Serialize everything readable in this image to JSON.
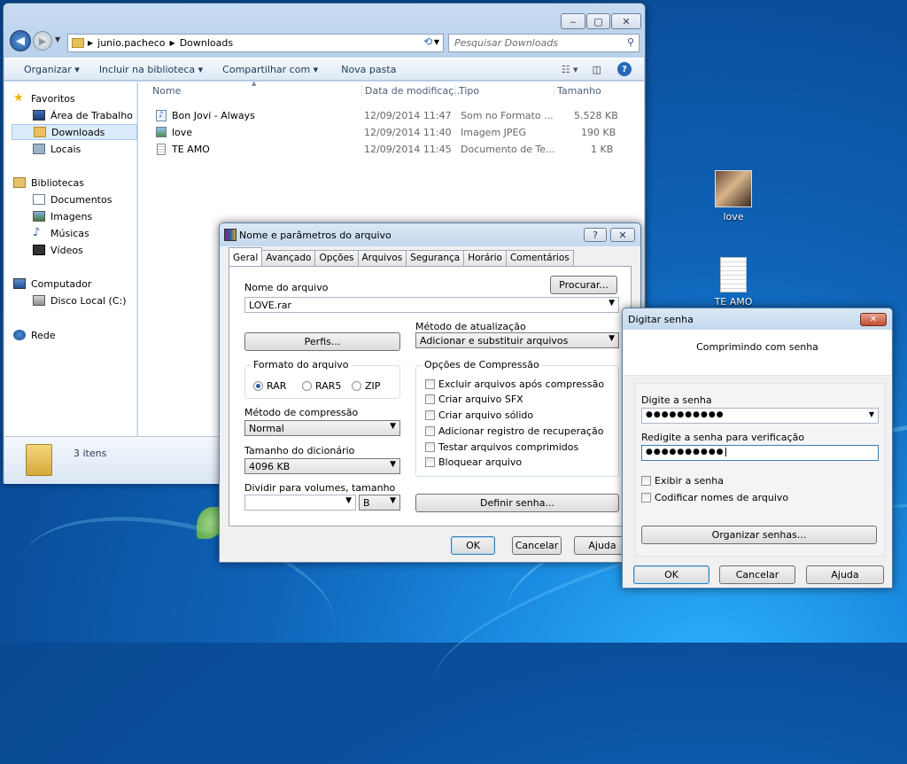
{
  "explorer": {
    "path_user": "junio.pacheco",
    "path_folder": "Downloads",
    "search_placeholder": "Pesquisar Downloads",
    "toolbar": {
      "organize": "Organizar",
      "include_library": "Incluir na biblioteca",
      "share": "Compartilhar com",
      "new_folder": "Nova pasta"
    },
    "nav": {
      "favorites": "Favoritos",
      "desktop": "Área de Trabalho",
      "downloads": "Downloads",
      "places": "Locais",
      "libraries": "Bibliotecas",
      "documents": "Documentos",
      "images": "Imagens",
      "music": "Músicas",
      "videos": "Vídeos",
      "computer": "Computador",
      "local_disk": "Disco Local (C:)",
      "network": "Rede"
    },
    "columns": {
      "name": "Nome",
      "date": "Data de modificaç...",
      "type": "Tipo",
      "size": "Tamanho"
    },
    "files": [
      {
        "name": "Bon Jovi - Always",
        "date": "12/09/2014 11:47",
        "type": "Som no Formato ...",
        "size": "5.528 KB"
      },
      {
        "name": "love",
        "date": "12/09/2014 11:40",
        "type": "Imagem JPEG",
        "size": "190 KB"
      },
      {
        "name": "TE AMO",
        "date": "12/09/2014 11:45",
        "type": "Documento de Te...",
        "size": "1 KB"
      }
    ],
    "item_count": "3 itens"
  },
  "desktop": {
    "icon1": "love",
    "icon2": "TE AMO"
  },
  "rar": {
    "title": "Nome e parâmetros do arquivo",
    "tabs": [
      "Geral",
      "Avançado",
      "Opções",
      "Arquivos",
      "Segurança",
      "Horário",
      "Comentários"
    ],
    "archive_name_label": "Nome do arquivo",
    "browse": "Procurar...",
    "archive_name": "LOVE.rar",
    "update_method_label": "Método de atualização",
    "update_method": "Adicionar e substituir arquivos",
    "profiles": "Perfis...",
    "format_label": "Formato do arquivo",
    "formats": [
      "RAR",
      "RAR5",
      "ZIP"
    ],
    "options_label": "Opções de Compressão",
    "options": [
      "Excluir arquivos após compressão",
      "Criar arquivo SFX",
      "Criar arquivo sólido",
      "Adicionar registro de recuperação",
      "Testar arquivos comprimidos",
      "Bloquear arquivo"
    ],
    "method_label": "Método de compressão",
    "method": "Normal",
    "dict_label": "Tamanho do dicionário",
    "dict": "4096 KB",
    "split_label": "Dividir para volumes, tamanho",
    "split_unit": "B",
    "set_password": "Definir senha...",
    "ok": "OK",
    "cancel": "Cancelar",
    "help": "Ajuda"
  },
  "pwd": {
    "title": "Digitar senha",
    "heading": "Comprimindo com senha",
    "enter_label": "Digite a senha",
    "password_mask": "●●●●●●●●●●",
    "reenter_label": "Redigite a senha para verificação",
    "reenter_mask": "●●●●●●●●●●",
    "show_password": "Exibir a senha",
    "encrypt_names": "Codificar nomes de arquivo",
    "organize": "Organizar senhas...",
    "ok": "OK",
    "cancel": "Cancelar",
    "help": "Ajuda"
  }
}
